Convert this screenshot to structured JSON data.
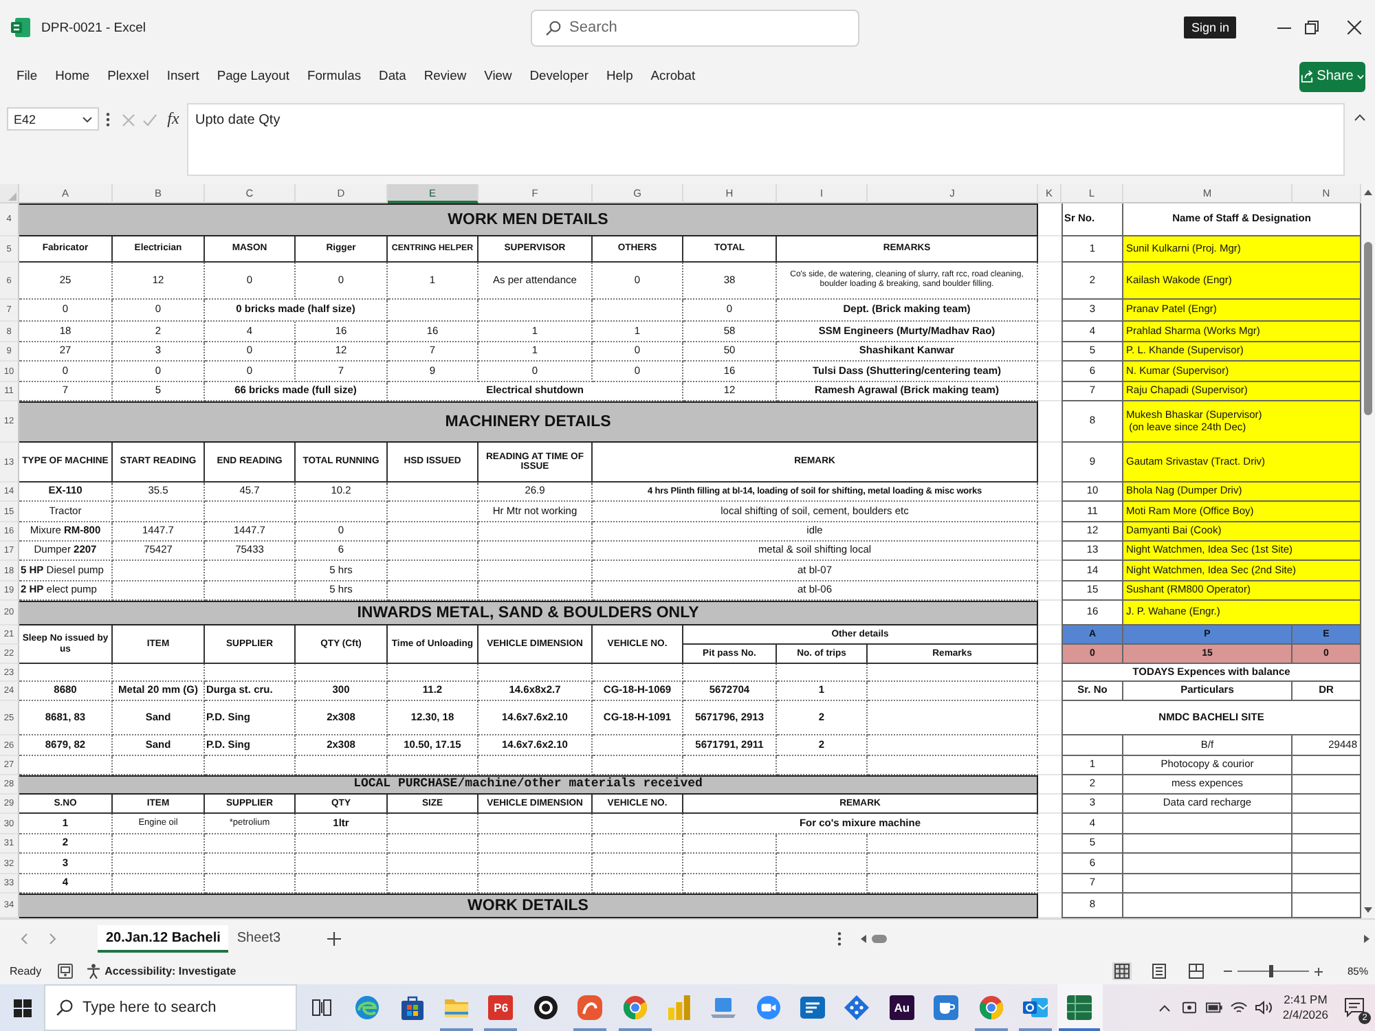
{
  "window": {
    "title": "DPR-0021 - Excel",
    "search": {
      "placeholder": "Search"
    },
    "sign_in": "Sign in"
  },
  "ribbon": {
    "tabs": [
      {
        "label": "File",
        "selected": false
      },
      {
        "label": "Home",
        "selected": false
      },
      {
        "label": "Plexxel",
        "selected": false
      },
      {
        "label": "Insert",
        "selected": false
      },
      {
        "label": "Page Layout",
        "selected": false
      },
      {
        "label": "Formulas",
        "selected": false
      },
      {
        "label": "Data",
        "selected": false
      },
      {
        "label": "Review",
        "selected": false
      },
      {
        "label": "View",
        "selected": false
      },
      {
        "label": "Developer",
        "selected": false
      },
      {
        "label": "Help",
        "selected": false
      },
      {
        "label": "Acrobat",
        "selected": false
      }
    ],
    "share": "Share"
  },
  "formula_bar": {
    "name_box": "E42",
    "function_label": "fx",
    "content": "Upto date Qty"
  },
  "sheet": {
    "columns": [
      {
        "label": "A",
        "selected": false
      },
      {
        "label": "B",
        "selected": false
      },
      {
        "label": "C",
        "selected": false
      },
      {
        "label": "D",
        "selected": false
      },
      {
        "label": "E",
        "selected": true
      },
      {
        "label": "F",
        "selected": false
      },
      {
        "label": "G",
        "selected": false
      },
      {
        "label": "H",
        "selected": false
      },
      {
        "label": "I",
        "selected": false
      },
      {
        "label": "J",
        "selected": false
      },
      {
        "label": "K",
        "selected": false
      },
      {
        "label": "L",
        "selected": false
      },
      {
        "label": "M",
        "selected": false
      },
      {
        "label": "N",
        "selected": false
      }
    ],
    "rows": [
      {
        "number": "4",
        "cells": [
          {
            "text": "WORK MEN DETAILS",
            "colspan": 10
          },
          "",
          "Sr No.",
          {
            "text": "Name of Staff & Designation",
            "colspan": 2
          }
        ]
      },
      {
        "number": "5",
        "cells": [
          "Fabricator",
          "Electrician",
          "MASON",
          "Rigger",
          "CENTRING HELPER",
          "SUPERVISOR",
          "OTHERS",
          "TOTAL",
          {
            "text": "REMARKS",
            "colspan": 2
          },
          "",
          "1",
          {
            "text": "Sunil Kulkarni (Proj. Mgr)",
            "colspan": 2
          }
        ]
      },
      {
        "number": "6",
        "cells": [
          "25",
          "12",
          "0",
          "0",
          "1",
          "As per attendance",
          "0",
          "38",
          {
            "text": "Co's side, de watering, cleaning of slurry, raft rcc, road cleaning, boulder loading & breaking, sand boulder filling.",
            "colspan": 2
          },
          "",
          "2",
          {
            "text": "Kailash Wakode (Engr)",
            "colspan": 2
          }
        ]
      },
      {
        "number": "7",
        "cells": [
          "0",
          "0",
          {
            "text": "0 bricks made (half size)",
            "colspan": 2
          },
          "",
          "",
          "",
          "0",
          {
            "text": "Dept. (Brick making team)",
            "colspan": 2
          },
          "",
          "3",
          {
            "text": "Pranav Patel (Engr)",
            "colspan": 2
          }
        ]
      },
      {
        "number": "8",
        "cells": [
          "18",
          "2",
          "4",
          "16",
          "16",
          "1",
          "1",
          "58",
          {
            "text": "SSM Engineers (Murty/Madhav Rao)",
            "colspan": 2
          },
          "",
          "4",
          {
            "text": "Prahlad Sharma (Works Mgr)",
            "colspan": 2
          }
        ]
      },
      {
        "number": "9",
        "cells": [
          "27",
          "3",
          "0",
          "12",
          "7",
          "1",
          "0",
          "50",
          {
            "text": "Shashikant Kanwar",
            "colspan": 2
          },
          "",
          "5",
          {
            "text": "P. L. Khande (Supervisor)",
            "colspan": 2
          }
        ]
      },
      {
        "number": "10",
        "cells": [
          "0",
          "0",
          "0",
          "7",
          "9",
          "0",
          "0",
          "16",
          {
            "text": "Tulsi Dass (Shuttering/centering team)",
            "colspan": 2
          },
          "",
          "6",
          {
            "text": "N. Kumar (Supervisor)",
            "colspan": 2
          }
        ]
      },
      {
        "number": "11",
        "cells": [
          "7",
          "5",
          {
            "text": "66 bricks made (full size)",
            "colspan": 2
          },
          {
            "text": "Electrical shutdown",
            "colspan": 3
          },
          "12",
          {
            "text": "Ramesh Agrawal (Brick making team)",
            "colspan": 2
          },
          "",
          "7",
          {
            "text": "Raju Chapadi (Supervisor)",
            "colspan": 2
          }
        ]
      },
      {
        "number": "12",
        "cells": [
          {
            "text": "MACHINERY DETAILS",
            "colspan": 10
          },
          "",
          "8",
          {
            "text": "Mukesh Bhaskar (Supervisor)\n (on leave since 24th Dec)",
            "colspan": 2
          }
        ]
      },
      {
        "number": "13",
        "cells": [
          "TYPE OF MACHINE",
          "START READING",
          "END READING",
          "TOTAL RUNNING",
          "HSD ISSUED",
          "READING AT TIME OF ISSUE",
          {
            "text": "REMARK",
            "colspan": 4
          },
          "",
          "9",
          {
            "text": "Gautam Srivastav (Tract. Driv)",
            "colspan": 2
          }
        ]
      },
      {
        "number": "14",
        "cells": [
          "EX-110",
          "35.5",
          "45.7",
          "10.2",
          "",
          "26.9",
          {
            "text": "4 hrs Plinth filling at bl-14, loading of soil for shifting, metal loading & misc works",
            "colspan": 4
          },
          "",
          "10",
          {
            "text": "Bhola Nag (Dumper Driv)",
            "colspan": 2
          }
        ]
      },
      {
        "number": "15",
        "cells": [
          "Tractor",
          "",
          "",
          "",
          "",
          "Hr Mtr not working",
          {
            "text": "local shifting of soil, cement, boulders etc",
            "colspan": 4
          },
          "",
          "11",
          {
            "text": "Moti Ram More (Office Boy)",
            "colspan": 2
          }
        ]
      },
      {
        "number": "16",
        "cells": [
          "Mixure **RM-800**",
          "1447.7",
          "1447.7",
          "0",
          "",
          "",
          {
            "text": "idle",
            "colspan": 4
          },
          "",
          "12",
          {
            "text": "Damyanti Bai (Cook)",
            "colspan": 2
          }
        ]
      },
      {
        "number": "17",
        "cells": [
          "Dumper **2207**",
          "75427",
          "75433",
          "6",
          "",
          "",
          {
            "text": "metal & soil shifting local",
            "colspan": 4
          },
          "",
          "13",
          {
            "text": "Night Watchmen, Idea Sec (1st Site)",
            "colspan": 2
          }
        ]
      },
      {
        "number": "18",
        "cells": [
          "**5 HP** Diesel pump",
          "",
          "",
          "5 hrs",
          "",
          "",
          {
            "text": "at bl-07",
            "colspan": 4
          },
          "",
          "14",
          {
            "text": "Night Watchmen, Idea Sec (2nd Site)",
            "colspan": 2
          }
        ]
      },
      {
        "number": "19",
        "cells": [
          "**2 HP** elect pump",
          "",
          "",
          "5 hrs",
          "",
          "",
          {
            "text": "at bl-06",
            "colspan": 4
          },
          "",
          "15",
          {
            "text": "Sushant (RM800 Operator)",
            "colspan": 2
          }
        ]
      },
      {
        "number": "20",
        "cells": [
          {
            "text": "INWARDS METAL, SAND & BOULDERS ONLY",
            "colspan": 10
          },
          "",
          "16",
          {
            "text": "J. P. Wahane (Engr.)",
            "colspan": 2
          }
        ]
      },
      {
        "number": "21",
        "cells": [
          {
            "text": "Sleep No issued by us",
            "rowspan": 2
          },
          {
            "text": "ITEM",
            "rowspan": 2
          },
          {
            "text": "SUPPLIER",
            "rowspan": 2
          },
          {
            "text": "QTY (Cft)",
            "rowspan": 2
          },
          {
            "text": "Time of Unloading",
            "rowspan": 2
          },
          {
            "text": "VEHICLE DIMENSION",
            "rowspan": 2
          },
          {
            "text": "VEHICLE NO.",
            "rowspan": 2
          },
          {
            "text": "Other details",
            "colspan": 3
          },
          "",
          "A",
          "P",
          "E"
        ]
      },
      {
        "number": "22",
        "cells": [
          "Pit pass No.",
          "No. of trips",
          "Remarks",
          "",
          "0",
          "15",
          "0"
        ]
      },
      {
        "number": "23",
        "cells": [
          "",
          "",
          "",
          "",
          "",
          "",
          "",
          "",
          "",
          "",
          "",
          {
            "text": "TODAYS Expences with balance",
            "colspan": 3
          }
        ]
      },
      {
        "number": "24",
        "cells": [
          "8680",
          "Metal 20 mm (G)",
          "Durga st. cru.",
          "300",
          "11.2",
          "14.6x8x2.7",
          "CG-18-H-1069",
          "5672704",
          "1",
          "",
          "",
          "Sr. No",
          "Particulars",
          "DR"
        ]
      },
      {
        "number": "25",
        "cells": [
          "8681, 83",
          "Sand",
          "P.D. Sing",
          "2x308",
          "12.30, 18",
          "14.6x7.6x2.10",
          "CG-18-H-1091",
          "5671796, 2913",
          "2",
          "",
          "",
          {
            "text": "NMDC BACHELI SITE",
            "colspan": 3
          }
        ]
      },
      {
        "number": "26",
        "cells": [
          "8679, 82",
          "Sand",
          "P.D. Sing",
          "2x308",
          "10.50, 17.15",
          "14.6x7.6x2.10",
          "",
          "5671791, 2911",
          "2",
          "",
          "",
          "",
          "B/f",
          "29448"
        ]
      },
      {
        "number": "27",
        "cells": [
          "",
          "",
          "",
          "",
          "",
          "",
          "",
          "",
          "",
          "",
          "",
          "1",
          "Photocopy & courior",
          ""
        ]
      },
      {
        "number": "28",
        "cells": [
          {
            "text": "LOCAL PURCHASE/machine/other materials received",
            "colspan": 10
          },
          "",
          "2",
          "mess expences",
          ""
        ]
      },
      {
        "number": "29",
        "cells": [
          "S.NO",
          "ITEM",
          "SUPPLIER",
          "QTY",
          "SIZE",
          "VEHICLE DIMENSION",
          "VEHICLE NO.",
          {
            "text": "REMARK",
            "colspan": 3
          },
          "",
          "3",
          "Data card recharge",
          ""
        ]
      },
      {
        "number": "30",
        "cells": [
          "1",
          "Engine oil",
          "*petrolium",
          "1ltr",
          "",
          "",
          "",
          {
            "text": "For co's mixure machine",
            "colspan": 3
          },
          "",
          "4",
          "",
          ""
        ]
      },
      {
        "number": "31",
        "cells": [
          "2",
          "",
          "",
          "",
          "",
          "",
          "",
          "",
          "",
          "",
          "",
          "5",
          "",
          ""
        ]
      },
      {
        "number": "32",
        "cells": [
          "3",
          "",
          "",
          "",
          "",
          "",
          "",
          "",
          "",
          "",
          "",
          "6",
          "",
          ""
        ]
      },
      {
        "number": "33",
        "cells": [
          "4",
          "",
          "",
          "",
          "",
          "",
          "",
          "",
          "",
          "",
          "",
          "7",
          "",
          ""
        ]
      },
      {
        "number": "34",
        "cells": [
          {
            "text": "WORK DETAILS",
            "colspan": 10
          },
          "",
          "8",
          "",
          ""
        ]
      }
    ]
  },
  "sheet_tabs": [
    {
      "label": "20.Jan.12 Bacheli",
      "selected": true
    },
    {
      "label": "Sheet3",
      "selected": false
    }
  ],
  "status_bar": {
    "status": "Ready",
    "accessibility": "Accessibility: Investigate",
    "views": [
      {
        "kind": "normal",
        "selected": true
      },
      {
        "kind": "page_layout",
        "selected": false
      },
      {
        "kind": "page_break",
        "selected": false
      }
    ],
    "zoom_slider": {
      "level": 0.46
    },
    "zoom": "85%"
  },
  "taskbar": {
    "search": {
      "placeholder": "Type here to search"
    },
    "apps": [
      {
        "kind": "swirl",
        "running": false,
        "active": false
      },
      {
        "kind": "bag",
        "running": false,
        "active": false
      },
      {
        "kind": "folder",
        "running": true,
        "active": false
      },
      {
        "kind": "tile",
        "label": "P6",
        "color": "#d8342c",
        "running": true,
        "active": false
      },
      {
        "kind": "ring",
        "running": false,
        "active": false
      },
      {
        "kind": "swoosh",
        "running": true,
        "active": false
      },
      {
        "kind": "wheel",
        "running": true,
        "active": false
      },
      {
        "kind": "bars",
        "running": false,
        "active": false
      },
      {
        "kind": "laptop",
        "running": false,
        "active": false
      },
      {
        "kind": "camera",
        "running": false,
        "active": false
      },
      {
        "kind": "card",
        "running": false,
        "active": false
      },
      {
        "kind": "diamond",
        "running": false,
        "active": false
      },
      {
        "kind": "tile",
        "label": "Au",
        "color": "#2b0a3d",
        "running": false,
        "active": false
      },
      {
        "kind": "cup",
        "running": false,
        "active": false
      },
      {
        "kind": "wheel",
        "running": true,
        "active": false
      },
      {
        "kind": "mail",
        "running": true,
        "active": false
      },
      {
        "kind": "sheet",
        "running": true,
        "active": true
      }
    ],
    "time": "2:41 PM",
    "date": "2/4/2026",
    "notifications": "2"
  }
}
